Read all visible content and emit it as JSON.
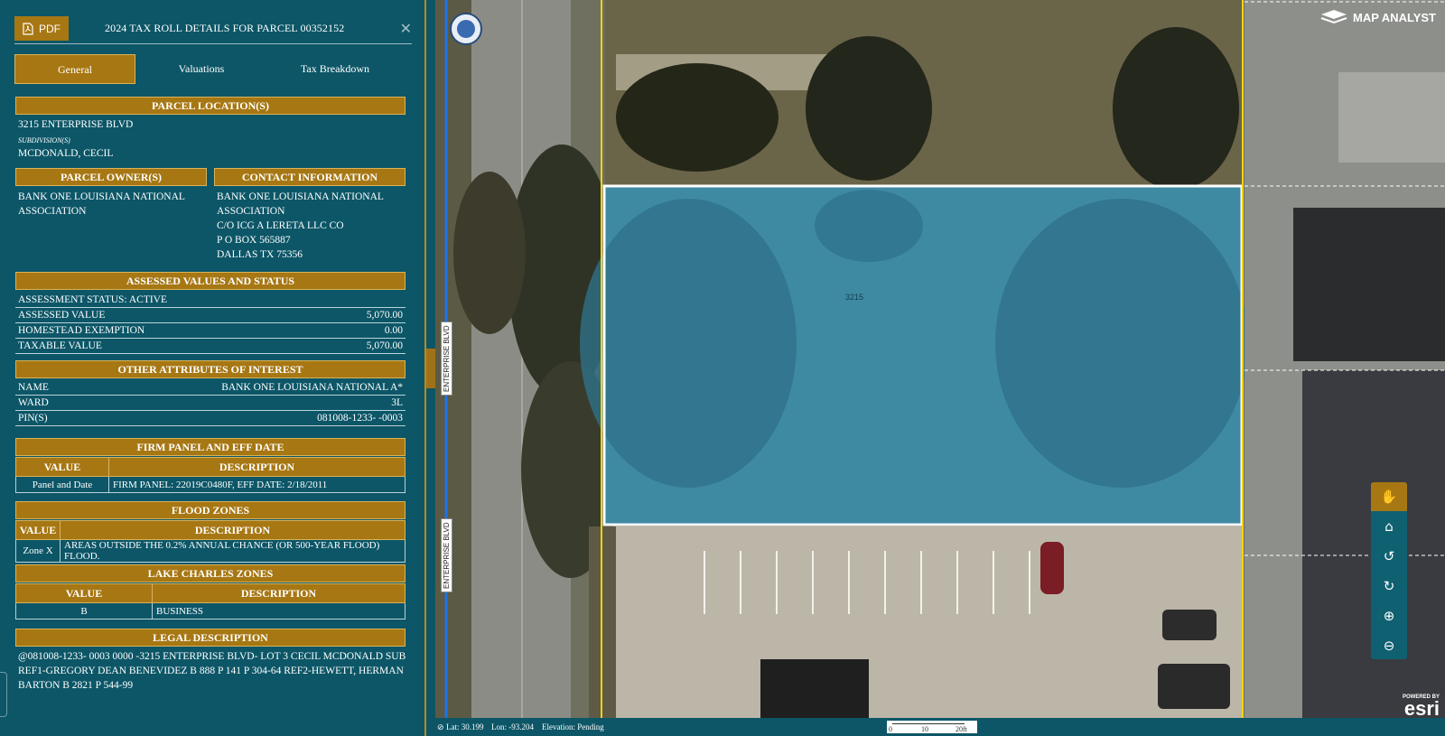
{
  "panel": {
    "pdf_label": "PDF",
    "title": "2024 TAX ROLL DETAILS FOR PARCEL 00352152",
    "close_icon": "close-icon",
    "tabs": [
      "General",
      "Valuations",
      "Tax Breakdown"
    ],
    "active_tab": "General"
  },
  "parcel_location": {
    "header": "PARCEL LOCATION(S)",
    "address": "3215 ENTERPRISE BLVD",
    "subdivision_label": "SUBDIVISION(S)",
    "subdivision": "MCDONALD, CECIL"
  },
  "owner": {
    "header": "PARCEL OWNER(S)",
    "line1": "BANK ONE LOUISIANA NATIONAL",
    "line2": "ASSOCIATION"
  },
  "contact": {
    "header": "CONTACT INFORMATION",
    "line1": "BANK ONE LOUISIANA NATIONAL",
    "line2": "ASSOCIATION",
    "line3": "C/O ICG A LERETA LLC CO",
    "line4": "P O BOX 565887",
    "line5": "DALLAS TX 75356"
  },
  "assessed": {
    "header": "ASSESSED VALUES AND STATUS",
    "status": "ASSESSMENT STATUS: ACTIVE",
    "rows": [
      {
        "label": "ASSESSED VALUE",
        "value": "5,070.00"
      },
      {
        "label": "HOMESTEAD EXEMPTION",
        "value": "0.00"
      },
      {
        "label": "TAXABLE VALUE",
        "value": "5,070.00"
      }
    ]
  },
  "other": {
    "header": "OTHER ATTRIBUTES OF INTEREST",
    "rows": [
      {
        "label": "NAME",
        "value": "BANK ONE LOUISIANA NATIONAL A*"
      },
      {
        "label": "WARD",
        "value": "3L"
      },
      {
        "label": "PIN(S)",
        "value": "081008-1233- -0003"
      }
    ]
  },
  "firm": {
    "header": "FIRM PANEL AND EFF DATE",
    "col1": "VALUE",
    "col2": "DESCRIPTION",
    "value": "Panel and Date",
    "description": "FIRM PANEL: 22019C0480F, EFF DATE: 2/18/2011"
  },
  "flood": {
    "header": "FLOOD ZONES",
    "col1": "VALUE",
    "col2": "DESCRIPTION",
    "value": "Zone X",
    "description": "AREAS OUTSIDE THE 0.2% ANNUAL CHANCE (OR 500-YEAR FLOOD) FLOOD."
  },
  "zones": {
    "header": "LAKE CHARLES ZONES",
    "col1": "VALUE",
    "col2": "DESCRIPTION",
    "value": "B",
    "description": "BUSINESS"
  },
  "legal": {
    "header": "LEGAL DESCRIPTION",
    "line1": "@081008-1233- 0003 0000 -3215 ENTERPRISE BLVD- LOT 3 CECIL MCDONALD SUB",
    "line2": "REF1-GREGORY DEAN BENEVIDEZ B 888 P 141 P 304-64 REF2-HEWETT, HERMAN",
    "line3": "BARTON B 2821 P 544-99"
  },
  "map": {
    "brand": "MAP ANALYST",
    "road_label_1": "ENTERPRISE BLVD",
    "road_label_2": "ENTERPRISE BLVD",
    "parcel_label": "3215",
    "tools": [
      "hand-icon",
      "home-icon",
      "undo-icon",
      "redo-icon",
      "zoom-in-icon",
      "zoom-out-icon"
    ],
    "esri_powered": "POWERED BY",
    "esri_name": "esri",
    "status": {
      "lat": "Lat: 30.199",
      "lon": "Lon: -93.204",
      "elevation": "Elevation: Pending"
    },
    "scale": {
      "s0": "0",
      "s1": "10",
      "s2": "20ft"
    }
  }
}
